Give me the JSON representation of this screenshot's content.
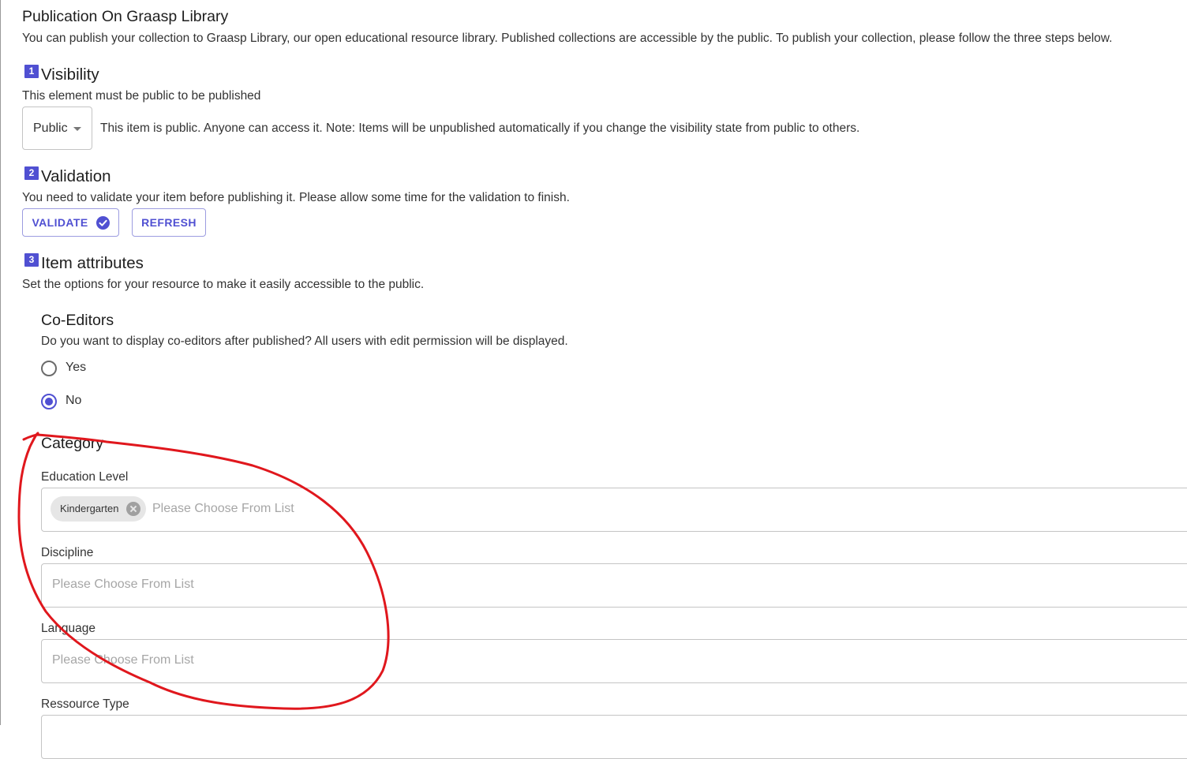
{
  "publication": {
    "title": "Publication On Graasp Library",
    "description": "You can publish your collection to Graasp Library, our open educational resource library. Published collections are accessible by the public. To publish your collection, please follow the three steps below."
  },
  "steps": {
    "visibility": {
      "number": "1",
      "title": "Visibility",
      "description": "This element must be public to be published",
      "select_value": "Public",
      "info": "This item is public. Anyone can access it. Note: Items will be unpublished automatically if you change the visibility state from public to others."
    },
    "validation": {
      "number": "2",
      "title": "Validation",
      "description": "You need to validate your item before publishing it. Please allow some time for the validation to finish.",
      "validate_label": "VALIDATE",
      "refresh_label": "REFRESH"
    },
    "attributes": {
      "number": "3",
      "title": "Item attributes",
      "description": "Set the options for your resource to make it easily accessible to the public."
    }
  },
  "coeditors": {
    "title": "Co-Editors",
    "question": "Do you want to display co-editors after published? All users with edit permission will be displayed.",
    "options": [
      {
        "label": "Yes",
        "checked": false
      },
      {
        "label": "No",
        "checked": true
      }
    ]
  },
  "category": {
    "title": "Category",
    "fields": [
      {
        "label": "Education Level",
        "placeholder": "Please Choose From List",
        "chips": [
          "Kindergarten"
        ]
      },
      {
        "label": "Discipline",
        "placeholder": "Please Choose From List",
        "chips": []
      },
      {
        "label": "Language",
        "placeholder": "Please Choose From List",
        "chips": []
      },
      {
        "label": "Ressource Type",
        "placeholder": "",
        "chips": []
      }
    ]
  },
  "colors": {
    "primary": "#5050d2",
    "annotation": "#e0171d"
  },
  "icons": {
    "select_caret": "arrow-drop-down-icon",
    "validate": "check-circle-icon",
    "chip_delete": "cancel-icon"
  }
}
